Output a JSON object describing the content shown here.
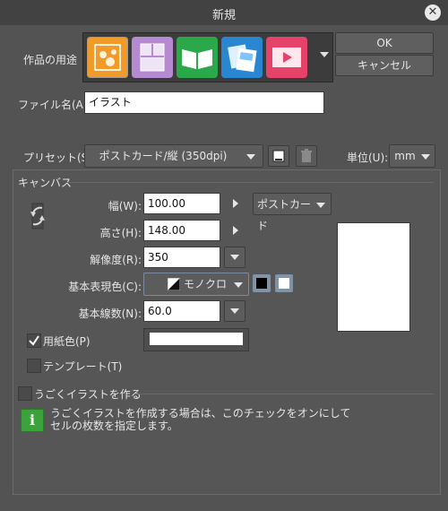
{
  "window": {
    "title": "新規",
    "close_icon": "close-icon"
  },
  "purpose": {
    "label": "作品の用途",
    "icons": [
      {
        "name": "illustration-icon",
        "color": "#f29a2a",
        "selected": true
      },
      {
        "name": "comic-icon",
        "color": "#b58ad0",
        "selected": false
      },
      {
        "name": "book-icon",
        "color": "#2ba84a",
        "selected": false
      },
      {
        "name": "webtoon-icon",
        "color": "#2b86d1",
        "selected": false
      },
      {
        "name": "animation-icon",
        "color": "#e5436a",
        "selected": false
      }
    ]
  },
  "buttons": {
    "ok": "OK",
    "cancel": "キャンセル"
  },
  "filename": {
    "label": "ファイル名(A):",
    "value": "イラスト"
  },
  "preset": {
    "label": "プリセット(S):",
    "value": "ポストカード/縦 (350dpi)"
  },
  "unit": {
    "label": "単位(U):",
    "value": "mm"
  },
  "canvas": {
    "section_label": "キャンバス",
    "width_label": "幅(W):",
    "width_value": "100.00",
    "height_label": "高さ(H):",
    "height_value": "148.00",
    "size_preset": "ポストカード",
    "resolution_label": "解像度(R):",
    "resolution_value": "350",
    "color_mode_label": "基本表現色(C):",
    "color_mode_value": "モノクロ",
    "lines_label": "基本線数(N):",
    "lines_value": "60.0",
    "paper_color_label": "用紙色(P)",
    "paper_color_checked": true,
    "template_label": "テンプレート(T)",
    "template_checked": false
  },
  "animation": {
    "label": "うごくイラストを作る",
    "checked": false,
    "info_line1": "うごくイラストを作成する場合は、このチェックをオンにして",
    "info_line2": "セルの枚数を指定します。"
  }
}
